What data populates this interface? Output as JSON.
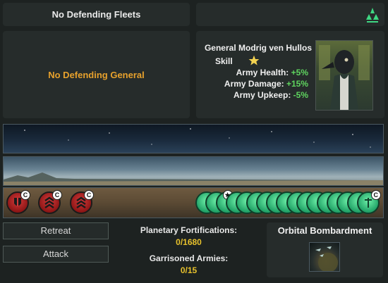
{
  "fleets": {
    "label": "No Defending Fleets",
    "icon": "fleet-triangle-icon"
  },
  "defending_general": {
    "label": "No Defending General"
  },
  "attacking_general": {
    "name": "General Modrig ven Hullos",
    "skill_label": "Skill",
    "skill_icon": "star-icon",
    "stats": [
      {
        "label": "Army Health:",
        "value": "+5%"
      },
      {
        "label": "Army Damage:",
        "value": "+15%"
      },
      {
        "label": "Army Upkeep:",
        "value": "-5%"
      }
    ]
  },
  "armies": {
    "attackers": [
      {
        "icon": "shield-army-icon",
        "badge": "C"
      },
      {
        "icon": "chevron-army-icon",
        "badge": "C"
      },
      {
        "icon": "chevron-army-icon",
        "badge": "C"
      }
    ],
    "defender_count": 17
  },
  "actions": {
    "retreat": "Retreat",
    "attack": "Attack"
  },
  "planet": {
    "fortifications_label": "Planetary Fortifications:",
    "fortifications_value": "0/1680",
    "armies_label": "Garrisoned Armies:",
    "armies_value": "0/15"
  },
  "bombardment": {
    "title": "Orbital Bombardment",
    "icon": "orbital-bombardment-icon"
  }
}
